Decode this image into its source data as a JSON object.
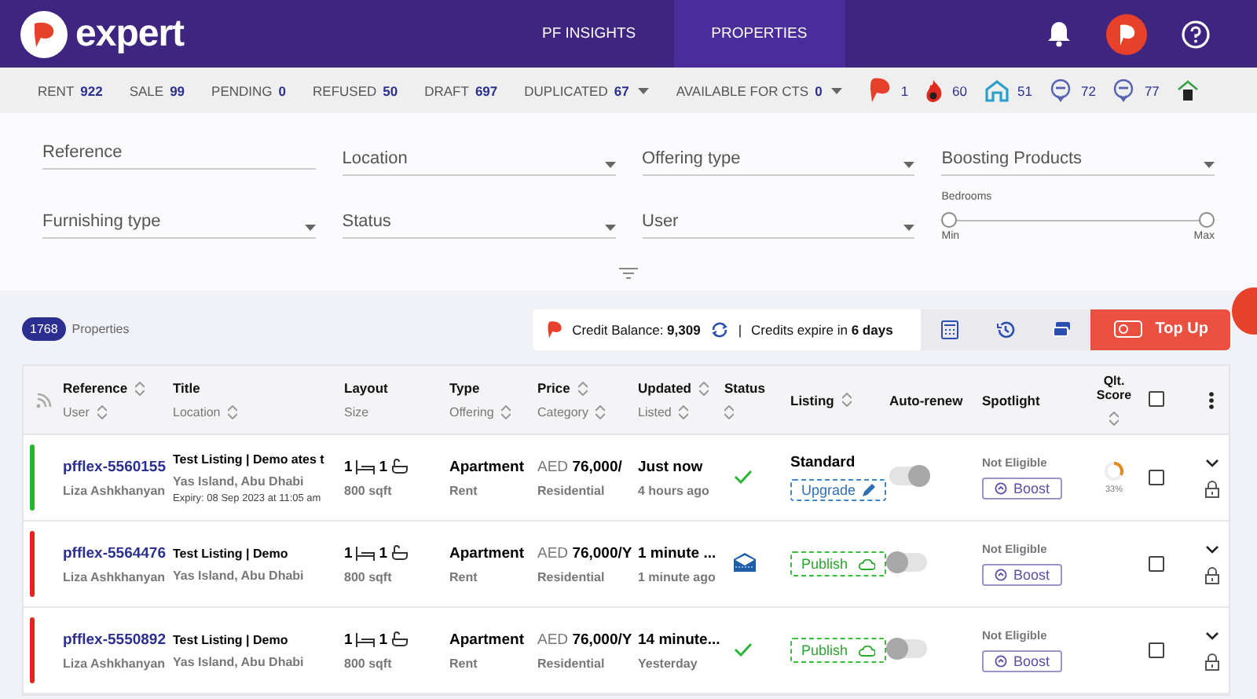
{
  "header": {
    "logo": "expert",
    "nav": [
      {
        "label": "PF INSIGHTS",
        "selected": false
      },
      {
        "label": "PROPERTIES",
        "selected": true
      }
    ]
  },
  "stats": [
    {
      "label": "RENT",
      "count": "922",
      "dropdown": false
    },
    {
      "label": "SALE",
      "count": "99",
      "dropdown": false
    },
    {
      "label": "PENDING",
      "count": "0",
      "dropdown": false
    },
    {
      "label": "REFUSED",
      "count": "50",
      "dropdown": false
    },
    {
      "label": "DRAFT",
      "count": "697",
      "dropdown": false
    },
    {
      "label": "DUPLICATED",
      "count": "67",
      "dropdown": true
    },
    {
      "label": "AVAILABLE FOR CTS",
      "count": "0",
      "dropdown": true
    }
  ],
  "icon_stats": [
    {
      "kind": "pf",
      "count": "1"
    },
    {
      "kind": "flame",
      "count": "60"
    },
    {
      "kind": "house",
      "count": "51"
    },
    {
      "kind": "badge",
      "count": "72"
    },
    {
      "kind": "badge",
      "count": "77"
    },
    {
      "kind": "building"
    }
  ],
  "filters": [
    {
      "kind": "text",
      "placeholder": "Reference"
    },
    {
      "kind": "select",
      "placeholder": "Location"
    },
    {
      "kind": "select",
      "placeholder": "Offering type"
    },
    {
      "kind": "select",
      "placeholder": "Boosting Products"
    },
    {
      "kind": "select",
      "placeholder": "Furnishing type"
    },
    {
      "kind": "select",
      "placeholder": "Status"
    },
    {
      "kind": "select",
      "placeholder": "User"
    },
    {
      "kind": "range",
      "label": "Bedrooms",
      "min": "Min",
      "max": "Max",
      "level": 1
    }
  ],
  "summary": {
    "count": "1768",
    "label": "Properties"
  },
  "credits": {
    "balance": "Credit Balance: **9,309**",
    "separator": "|",
    "expiry": "Credits expire in **6 days**",
    "top_up": "Top Up"
  },
  "columns": [
    {
      "label": "Reference",
      "sub": "User",
      "sort": true,
      "sub_sort": true
    },
    {
      "label": "Title",
      "sub": "Location",
      "sort": false,
      "sub_sort": true
    },
    {
      "label": "Layout",
      "sub": "Size",
      "sort": false,
      "sub_sort": false
    },
    {
      "label": "Type",
      "sub": "Offering",
      "sort": false,
      "sub_sort": true
    },
    {
      "label": "Price",
      "sub": "Category",
      "sort": true,
      "sub_sort": true
    },
    {
      "label": "Updated",
      "sub": "Listed",
      "sort": true,
      "sub_sort": true
    },
    {
      "label": "Status",
      "sort": false,
      "sub_sort": true
    },
    {
      "label": "Listing",
      "sort": true,
      "sub_sort": false
    },
    {
      "label": "Auto-renew",
      "sort": false,
      "sub_sort": false
    },
    {
      "label": "Spotlight",
      "sort": false,
      "sub_sort": false
    },
    {
      "label": "Qlt. Score",
      "sort": false,
      "sub_sort": true
    }
  ],
  "header_checkbox": {
    "checked": false
  },
  "rows": [
    {
      "color": "#1fb829",
      "reference": "pfflex-5560155",
      "user": "Liza Ashkhanyan",
      "title": "Test Listing | Demo ates t",
      "location": "Yas Island, Abu Dhabi",
      "expiry": "Expiry: 08 Sep 2023 at 11:05 am",
      "beds": "1",
      "baths": "1",
      "size": "800 sqft",
      "type": "Apartment",
      "offering": "Rent",
      "currency": "AED",
      "price": "76,000/",
      "category": "Residential",
      "updated": "Just now",
      "listed": "4 hours ago",
      "status": {
        "kind": "check"
      },
      "listing": {
        "kind": "standard",
        "label": "Standard",
        "action": "Upgrade"
      },
      "auto_renew": true,
      "spotlight": "Not Eligible",
      "boost": "Boost",
      "score": {
        "text": "33%"
      },
      "checked": false
    },
    {
      "color": "#e8231c",
      "reference": "pfflex-5564476",
      "user": "Liza Ashkhanyan",
      "title": "Test Listing | Demo",
      "location": "Yas Island, Abu Dhabi",
      "beds": "1",
      "baths": "1",
      "size": "800 sqft",
      "type": "Apartment",
      "offering": "Rent",
      "currency": "AED",
      "price": "76,000/Y",
      "category": "Residential",
      "updated": "1 minute ...",
      "listed": "1 minute ago",
      "status": {
        "kind": "mail"
      },
      "listing": {
        "kind": "publish",
        "action": "Publish"
      },
      "auto_renew": false,
      "spotlight": "Not Eligible",
      "boost": "Boost",
      "checked": false
    },
    {
      "color": "#e8231c",
      "reference": "pfflex-5550892",
      "user": "Liza Ashkhanyan",
      "title": "Test Listing | Demo",
      "location": "Yas Island, Abu Dhabi",
      "beds": "1",
      "baths": "1",
      "size": "800 sqft",
      "type": "Apartment",
      "offering": "Rent",
      "currency": "AED",
      "price": "76,000/Y",
      "category": "Residential",
      "updated": "14 minute...",
      "listed": "Yesterday",
      "status": {
        "kind": "check"
      },
      "listing": {
        "kind": "publish",
        "action": "Publish"
      },
      "auto_renew": false,
      "spotlight": "Not Eligible",
      "boost": "Boost",
      "checked": false
    }
  ]
}
